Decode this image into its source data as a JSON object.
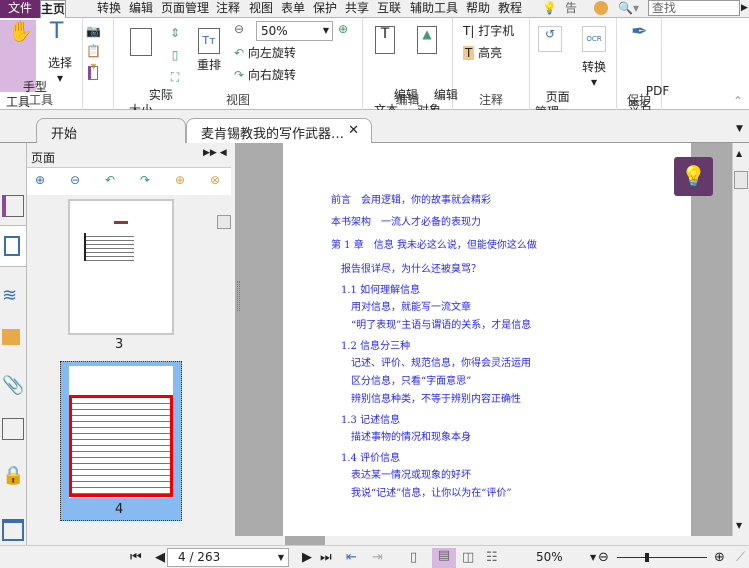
{
  "menubar": {
    "file": "文件",
    "tabs": [
      "主页",
      "转换",
      "编辑",
      "页面管理",
      "注释",
      "视图",
      "表单",
      "保护",
      "共享",
      "互联",
      "辅助工具",
      "帮助",
      "教程"
    ],
    "tell": "告诉",
    "search_placeholder": "查找"
  },
  "ribbon": {
    "tools": {
      "hand": "手型\n工具",
      "select": "选择",
      "label": "工具"
    },
    "view": {
      "actual": "实际\n大小",
      "reflow": "重排",
      "zoom": "50%",
      "rotate_left": "向左旋转",
      "rotate_right": "向右旋转",
      "label": "视图"
    },
    "edit": {
      "edit_text": "编辑\n文本",
      "edit_object": "编辑\n对象",
      "label": "编辑"
    },
    "comment": {
      "typewriter": "打字机",
      "highlight": "高亮",
      "label": "注释"
    },
    "page_mgmt": {
      "label": "页面\n管理"
    },
    "convert": {
      "label": "转换"
    },
    "protect": {
      "pdf_sign": "PDF\n签名",
      "label": "保护"
    }
  },
  "tabs": {
    "start": "开始",
    "doc": "麦肯锡教我的写作武器…"
  },
  "panel": {
    "title": "页面",
    "thumbs": [
      {
        "label": "3"
      },
      {
        "label": "4"
      }
    ]
  },
  "document": {
    "lines": [
      "前言　会用逻辑，你的故事就会精彩",
      "本书架构　一流人才必备的表现力",
      "第 1 章　信息 我未必这么说，但能使你这么做",
      "报告很详尽，为什么还被臭骂？",
      "1.1 如何理解信息",
      "用对信息，就能写一流文章",
      "“明了表现”主语与谓语的关系，才是信息",
      "1.2 信息分三种",
      "记述、评价、规范信息，你得会灵活运用",
      "区分信息，只看“字面意思”",
      "辨别信息种类，不等于辨别内容正确性",
      "1.3 记述信息",
      "描述事物的情况和现象本身",
      "1.4 评价信息",
      "表达某一情况或现象的好坏",
      "我说“记述”信息，让你以为在“评价”"
    ]
  },
  "status": {
    "page": "4 / 263",
    "zoom": "50%"
  },
  "colors": {
    "accent": "#6b2a6b",
    "text_blue": "#2a2ae8"
  }
}
